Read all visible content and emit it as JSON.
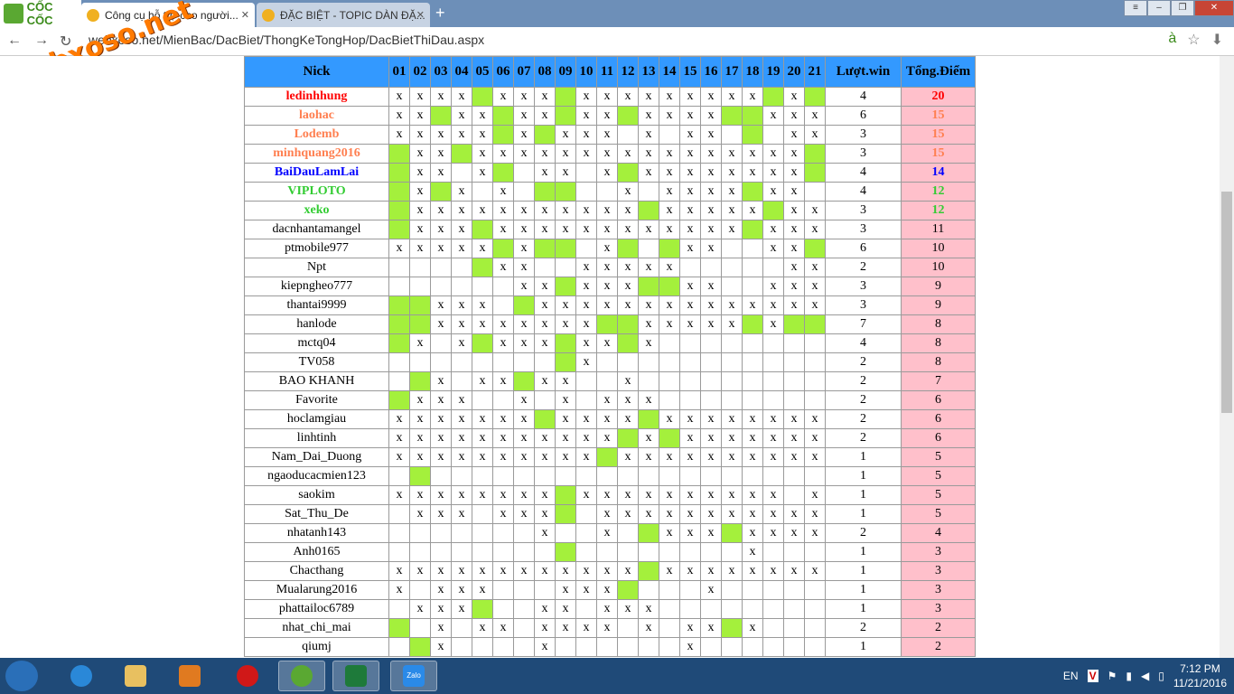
{
  "browser": {
    "brand": "CỐC CỐC",
    "tabs": [
      {
        "label": "Công cụ hỗ trợ cho người..."
      },
      {
        "label": "ĐẶC BIỆT - TOPIC DÀN ĐẶ..."
      }
    ],
    "url": "webxoso.net/MienBac/DacBiet/ThongKeTongHop/DacBietThiDau.aspx",
    "overlay_logo": "webxoso.net"
  },
  "table": {
    "headers": {
      "nick": "Nick",
      "days": [
        "01",
        "02",
        "03",
        "04",
        "05",
        "06",
        "07",
        "08",
        "09",
        "10",
        "11",
        "12",
        "13",
        "14",
        "15",
        "16",
        "17",
        "18",
        "19",
        "20",
        "21"
      ],
      "wins": "Lượt.win",
      "total": "Tổng.Điểm"
    },
    "rows": [
      {
        "nick": "ledinhhung",
        "color": "#ff0000",
        "bold": true,
        "cells": "xxxxgxxxgxxxxxxxxxgxg",
        "wins": "4",
        "total": "20"
      },
      {
        "nick": "laohac",
        "color": "#ff7f50",
        "bold": true,
        "cells": "xxgxxgxxgxxgxxxxggxxx",
        "wins": "6",
        "total": "15"
      },
      {
        "nick": "Lodemb",
        "color": "#ff7f50",
        "bold": true,
        "cells": "xxxxxgxgxxx.x.xx.g.xx",
        "wins": "3",
        "total": "15"
      },
      {
        "nick": "minhquang2016",
        "color": "#ff7f50",
        "bold": true,
        "cells": "gxxgxxxxxxxxxxxxxxxxg",
        "wins": "3",
        "total": "15"
      },
      {
        "nick": "BaiDauLamLai",
        "color": "#0000ff",
        "bold": true,
        "cells": "gxx.xg.xx.xgxxxxxxxxg",
        "wins": "4",
        "total": "14"
      },
      {
        "nick": "VIPLOTO",
        "color": "#33cc33",
        "bold": true,
        "cells": "gxgx.x.gg..x.xxxxgxx.x",
        "wins": "4",
        "total": "12"
      },
      {
        "nick": "xeko",
        "color": "#33cc33",
        "bold": true,
        "cells": "gxxxxxxxxxxxgxxxxxgxx",
        "wins": "3",
        "total": "12"
      },
      {
        "nick": "dacnhantamangel",
        "color": "#000000",
        "bold": false,
        "cells": "gxxxgxxxxxxxxxxxxgxxx",
        "wins": "3",
        "total": "11"
      },
      {
        "nick": "ptmobile977",
        "color": "#000000",
        "bold": false,
        "cells": "xxxxxgxgg.xg.gxx..xxgx",
        "wins": "6",
        "total": "10"
      },
      {
        "nick": "Npt",
        "color": "#000000",
        "bold": false,
        "cells": "....gxx..xxxxx.....xxxg",
        "wins": "2",
        "total": "10"
      },
      {
        "nick": "kiepngheo777",
        "color": "#000000",
        "bold": false,
        "cells": "......xxgxxxggxx..xxx",
        "wins": "3",
        "total": "9"
      },
      {
        "nick": "thantai9999",
        "color": "#000000",
        "bold": false,
        "cells": "ggxxx.gxxxxxxxxxxxxxx",
        "wins": "3",
        "total": "9"
      },
      {
        "nick": "hanlode",
        "color": "#000000",
        "bold": false,
        "cells": "ggxxxxxxxxggxxxxxgxgg",
        "wins": "7",
        "total": "8"
      },
      {
        "nick": "mctq04",
        "color": "#000000",
        "bold": false,
        "cells": "gx.xgxxxgxxgx........",
        "wins": "4",
        "total": "8"
      },
      {
        "nick": "TV058",
        "color": "#000000",
        "bold": false,
        "cells": "........gx...........",
        "wins": "2",
        "total": "8"
      },
      {
        "nick": "BAO KHANH",
        "color": "#000000",
        "bold": false,
        "cells": ".gx.xxgxx..x.........",
        "wins": "2",
        "total": "7"
      },
      {
        "nick": "Favorite",
        "color": "#000000",
        "bold": false,
        "cells": "gxxx..x.x.xxx........",
        "wins": "2",
        "total": "6"
      },
      {
        "nick": "hoclamgiau",
        "color": "#000000",
        "bold": false,
        "cells": "xxxxxxxgxxxxgxxxxxxxx",
        "wins": "2",
        "total": "6"
      },
      {
        "nick": "linhtinh",
        "color": "#000000",
        "bold": false,
        "cells": "xxxxxxxxxxxgxgxxxxxxx",
        "wins": "2",
        "total": "6"
      },
      {
        "nick": "Nam_Dai_Duong",
        "color": "#000000",
        "bold": false,
        "cells": "xxxxxxxxxxgxxxxxxxxxx",
        "wins": "1",
        "total": "5"
      },
      {
        "nick": "ngaoducacmien123",
        "color": "#000000",
        "bold": false,
        "cells": ".g...................",
        "wins": "1",
        "total": "5"
      },
      {
        "nick": "saokim",
        "color": "#000000",
        "bold": false,
        "cells": "xxxxxxxxgxxxxxxxxxx.x",
        "wins": "1",
        "total": "5"
      },
      {
        "nick": "Sat_Thu_De",
        "color": "#000000",
        "bold": false,
        "cells": ".xxx.xxxg.xxxxxxxxxxx",
        "wins": "1",
        "total": "5"
      },
      {
        "nick": "nhatanh143",
        "color": "#000000",
        "bold": false,
        "cells": ".......x..x.gxxxgxxxx",
        "wins": "2",
        "total": "4"
      },
      {
        "nick": "Anh0165",
        "color": "#000000",
        "bold": false,
        "cells": "........g........x...",
        "wins": "1",
        "total": "3"
      },
      {
        "nick": "Chacthang",
        "color": "#000000",
        "bold": false,
        "cells": "xxxxxxxxxxxxgxxxxxxxx",
        "wins": "1",
        "total": "3"
      },
      {
        "nick": "Mualarung2016",
        "color": "#000000",
        "bold": false,
        "cells": "x.xxx...xxxg...x.....",
        "wins": "1",
        "total": "3"
      },
      {
        "nick": "phattailoc6789",
        "color": "#000000",
        "bold": false,
        "cells": ".xxxg..xx.xxx........",
        "wins": "1",
        "total": "3"
      },
      {
        "nick": "nhat_chi_mai",
        "color": "#000000",
        "bold": false,
        "cells": "g.x.xx.xxxx.x.xxgx...",
        "wins": "2",
        "total": "2"
      },
      {
        "nick": "qiumj",
        "color": "#000000",
        "bold": false,
        "cells": ".gx....x......x......",
        "wins": "1",
        "total": "2"
      }
    ]
  },
  "taskbar": {
    "lang": "EN",
    "time": "7:12 PM",
    "date": "11/21/2016",
    "app_label": "Zalo"
  }
}
